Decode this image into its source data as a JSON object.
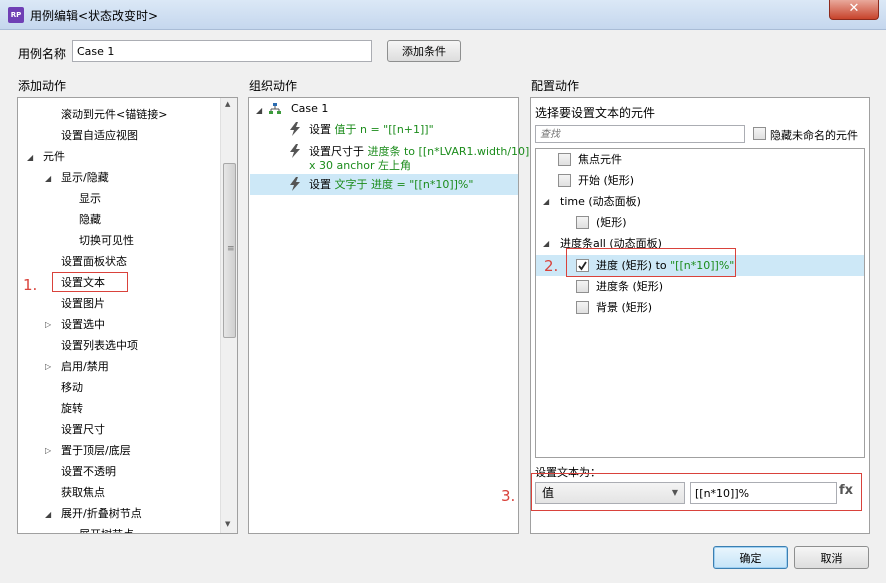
{
  "window": {
    "icon_text": "RP",
    "title": "用例编辑<状态改变时>",
    "close_glyph": "✕"
  },
  "case_name": {
    "label": "用例名称",
    "value": "Case 1",
    "add_condition_label": "添加条件"
  },
  "sections": {
    "add_action": "添加动作",
    "organize_action": "组织动作",
    "configure_action": "配置动作"
  },
  "add_actions": {
    "items": [
      "滚动到元件<锚链接>",
      "设置自适应视图",
      "元件",
      "显示/隐藏",
      "显示",
      "隐藏",
      "切换可见性",
      "设置面板状态",
      "设置文本",
      "设置图片",
      "设置选中",
      "设置列表选中项",
      "启用/禁用",
      "移动",
      "旋转",
      "设置尺寸",
      "置于顶层/底层",
      "设置不透明",
      "获取焦点",
      "展开/折叠树节点",
      "展开树节点"
    ],
    "marker": "1."
  },
  "organize": {
    "case_label": "Case 1",
    "action1_prefix": "设置",
    "action1_detail": "值于 n = \"[[n+1]]\"",
    "action2_prefix": "设置尺寸于",
    "action2_detail": "进度条 to [[n*LVAR1.width/10]]",
    "action2_line2": "x 30 anchor 左上角",
    "action3_prefix": "设置",
    "action3_detail": "文字于 进度 = \"[[n*10]]%\""
  },
  "configure": {
    "select_label": "选择要设置文本的元件",
    "search_placeholder": "查找",
    "hide_unnamed_label": "隐藏未命名的元件",
    "widgets": {
      "focus": "焦点元件",
      "start": "开始 (矩形)",
      "time_panel": "time (动态面板)",
      "time_rect": "(矩形)",
      "progress_all": "进度条all (动态面板)",
      "progress_name": "进度 (矩形) to",
      "progress_value": "\"[[n*10]]%\"",
      "progress_bar": "进度条 (矩形)",
      "background": "背景 (矩形)"
    },
    "marker2": "2.",
    "set_text_label": "设置文本为：",
    "value_type": "值",
    "value": "[[n*10]]%",
    "fx_label": "fx",
    "marker3": "3."
  },
  "footer": {
    "ok_label": "确定",
    "cancel_label": "取消"
  },
  "colors": {
    "highlight": "#cde8f7",
    "green_text": "#1c8c1c",
    "red_marker": "#d9423b"
  }
}
